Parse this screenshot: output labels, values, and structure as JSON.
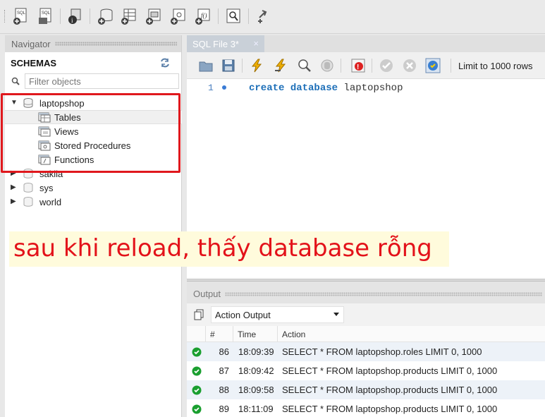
{
  "navigator": {
    "title": "Navigator",
    "schemas_label": "SCHEMAS",
    "filter_placeholder": "Filter objects",
    "schemas": [
      {
        "name": "laptopshop",
        "expanded": true,
        "children": [
          "Tables",
          "Views",
          "Stored Procedures",
          "Functions"
        ]
      },
      {
        "name": "sakila",
        "expanded": false
      },
      {
        "name": "sys",
        "expanded": false
      },
      {
        "name": "world",
        "expanded": false
      }
    ]
  },
  "editor": {
    "tab_label": "SQL File 3*",
    "tab_close": "×",
    "limit_label": "Limit to 1000 rows",
    "line_number": "1",
    "code": {
      "kw1": "create",
      "kw2": "database",
      "name": "laptopshop"
    }
  },
  "annotation": {
    "caption": "sau khi reload, thấy database rỗng",
    "color": "#e3121a"
  },
  "output": {
    "title": "Output",
    "selector_value": "Action Output",
    "columns": [
      "#",
      "Time",
      "Action"
    ],
    "rows": [
      {
        "num": "86",
        "time": "18:09:39",
        "action": "SELECT * FROM laptopshop.roles LIMIT 0, 1000"
      },
      {
        "num": "87",
        "time": "18:09:42",
        "action": "SELECT * FROM laptopshop.products LIMIT 0, 1000"
      },
      {
        "num": "88",
        "time": "18:09:58",
        "action": "SELECT * FROM laptopshop.products LIMIT 0, 1000"
      },
      {
        "num": "89",
        "time": "18:11:09",
        "action": "SELECT * FROM laptopshop.products LIMIT 0, 1000"
      }
    ]
  }
}
